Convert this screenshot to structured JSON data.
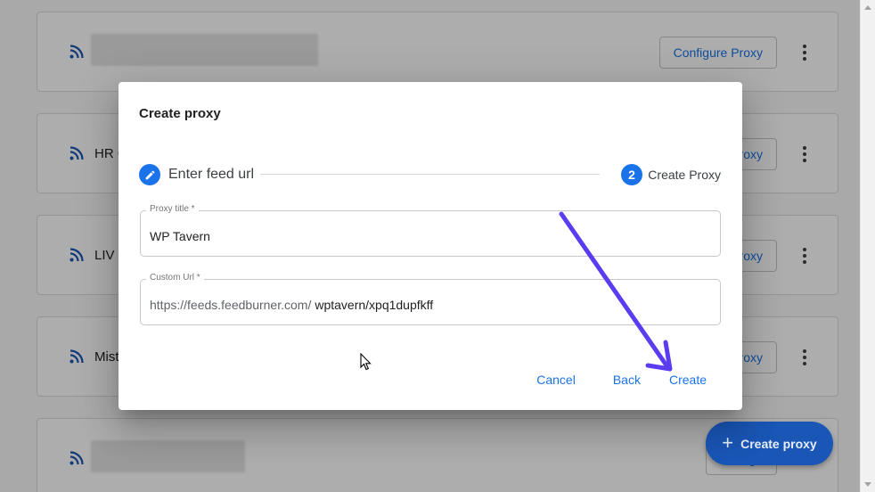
{
  "background": {
    "cards": [
      {
        "name": "",
        "configure_label": "Configure Proxy",
        "blurred": true
      },
      {
        "name": "HR C",
        "configure_label": "roxy",
        "blurred": false
      },
      {
        "name": "LIV S",
        "configure_label": "roxy",
        "blurred": false
      },
      {
        "name": "Mist",
        "configure_label": "roxy",
        "blurred": false
      },
      {
        "name": "",
        "configure_label": "Configu",
        "blurred": true
      }
    ],
    "fab_label": "Create proxy",
    "fab_icon": "plus-icon"
  },
  "dialog": {
    "title": "Create proxy",
    "stepper": {
      "step1": {
        "label": "Enter feed url",
        "icon": "edit-pencil-icon",
        "state": "completed"
      },
      "step2": {
        "number": "2",
        "label": "Create Proxy",
        "state": "active"
      }
    },
    "fields": {
      "proxy_title": {
        "label": "Proxy title *",
        "value": "WP Tavern"
      },
      "custom_url": {
        "label": "Custom Url *",
        "prefix": "https://feeds.feedburner.com/",
        "value": "wptavern/xpq1dupfkff"
      }
    },
    "actions": {
      "cancel": "Cancel",
      "back": "Back",
      "create": "Create"
    }
  },
  "colors": {
    "primary": "#1a73e8",
    "annotation_arrow": "#5b3cf0",
    "fab": "#1a56b6"
  }
}
